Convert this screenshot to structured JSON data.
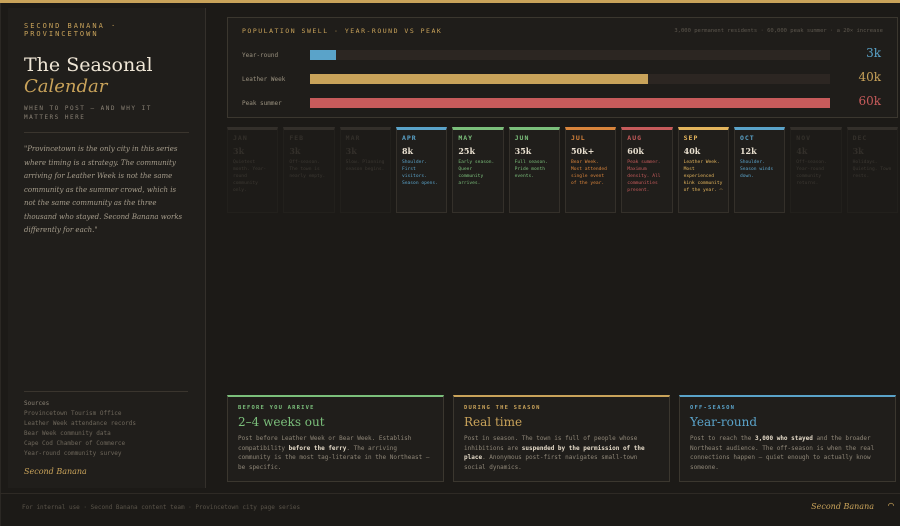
{
  "sidebar": {
    "brand": "SECOND BANANA · PROVINCETOWN",
    "title_line1": "The Seasonal",
    "title_line2": "Calendar",
    "subtitle": "WHEN TO POST — AND WHY IT MATTERS HERE",
    "quote": "\"Provincetown is the only city in this series where timing is a strategy. The community arriving for Leather Week is not the same community as the summer crowd, which is not the same community as the three thousand who stayed. Second Banana works differently for each.\"",
    "sources_heading": "Sources",
    "sources": [
      "Provincetown Tourism Office",
      "Leather Week attendance records",
      "Bear Week community data",
      "Cape Cod Chamber of Commerce",
      "Year-round community survey"
    ],
    "brand_sign": "Second Banana"
  },
  "population": {
    "title": "POPULATION SWELL · YEAR-ROUND VS PEAK",
    "note": "3,000 permanent residents · 60,000 peak summer · a 20× increase",
    "rows": [
      {
        "label": "Year-round",
        "value": "3k",
        "fraction": 0.05,
        "color": "#5aa3c9"
      },
      {
        "label": "Leather Week",
        "value": "40k",
        "fraction": 0.65,
        "color": "#c9a35a"
      },
      {
        "label": "Peak summer",
        "value": "60k",
        "fraction": 1.0,
        "color": "#c75b5b"
      }
    ]
  },
  "months": [
    {
      "name": "JAN",
      "num": "3k",
      "desc": "Quietest month. Year-round community only.",
      "color": "#6e675b",
      "active": false
    },
    {
      "name": "FEB",
      "num": "3k",
      "desc": "Off-season. The town is nearly empty.",
      "color": "#6e675b",
      "active": false
    },
    {
      "name": "MAR",
      "num": "3k",
      "desc": "Slow. Planning season begins.",
      "color": "#6e675b",
      "active": false
    },
    {
      "name": "APR",
      "num": "8k",
      "desc": "Shoulder. First visitors. Season opens.",
      "color": "#5aa3c9",
      "active": true
    },
    {
      "name": "MAY",
      "num": "25k",
      "desc": "Early season. Queer community arrives.",
      "color": "#7bbf7b",
      "active": true
    },
    {
      "name": "JUN",
      "num": "35k",
      "desc": "Full season. Pride month events.",
      "color": "#7bbf7b",
      "active": true
    },
    {
      "name": "JUL",
      "num": "50k+",
      "desc": "Bear Week. Most attended single event of the year.",
      "color": "#d9843b",
      "active": true
    },
    {
      "name": "AUG",
      "num": "60k",
      "desc": "Peak summer. Maximum density. All communities present.",
      "color": "#c75b5b",
      "active": true
    },
    {
      "name": "SEP",
      "num": "40k",
      "desc": "Leather Week. Most experienced kink community of the year.",
      "color": "#e3b45c",
      "active": true,
      "icon": "banana-icon"
    },
    {
      "name": "OCT",
      "num": "12k",
      "desc": "Shoulder. Season winds down.",
      "color": "#5aa3c9",
      "active": true
    },
    {
      "name": "NOV",
      "num": "4k",
      "desc": "Off-season. Year-round community returns.",
      "color": "#6e675b",
      "active": false
    },
    {
      "name": "DEC",
      "num": "3k",
      "desc": "Holidays. Quieting. Town rests.",
      "color": "#6e675b",
      "active": false
    }
  ],
  "cards": [
    {
      "kicker": "BEFORE YOU ARRIVE",
      "title": "2–4 weeks out",
      "color": "#7bbf7b",
      "body_a": "Post before Leather Week or Bear Week. Establish compatibility ",
      "body_b": "before the ferry",
      "body_c": ". The arriving community is the most tag-literate in the Northeast — be specific."
    },
    {
      "kicker": "DURING THE SEASON",
      "title": "Real time",
      "color": "#c9a35a",
      "body_a": "Post in season. The town is full of people whose inhibitions are ",
      "body_b": "suspended by the permission of the place",
      "body_c": ". Anonymous post-first navigates small-town social dynamics."
    },
    {
      "kicker": "OFF-SEASON",
      "title": "Year-round",
      "color": "#5aa3c9",
      "body_a": "Post to reach the ",
      "body_b": "3,000 who stayed",
      "body_c": " and the broader Northeast audience. The off-season is when the real connections happen — quiet enough to actually know someone."
    }
  ],
  "footer": {
    "left": "For internal use · Second Banana content team · Provincetown city page series",
    "right": "Second Banana",
    "icon": "banana-icon"
  }
}
